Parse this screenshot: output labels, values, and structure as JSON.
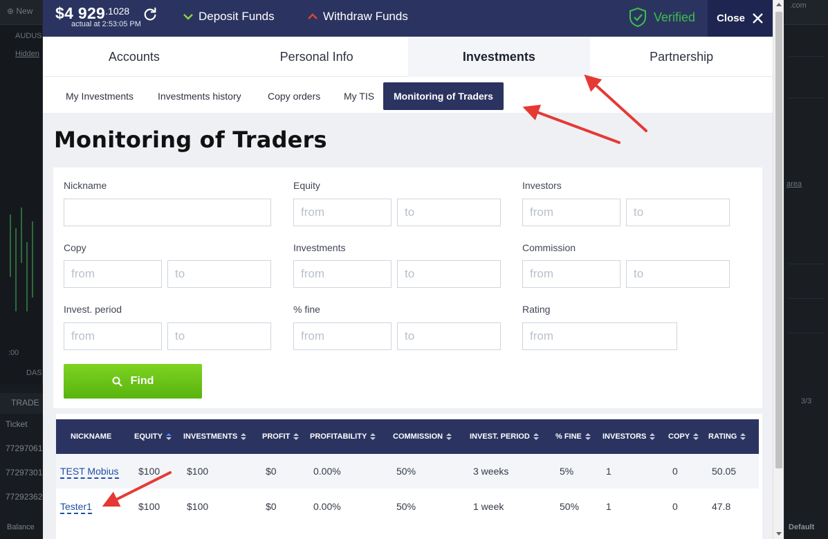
{
  "background": {
    "new_label": "New",
    "symbol": "AUDUS",
    "hidden_link": "Hidden",
    "trade_tab": "TRADE",
    "ticket_header": "Ticket",
    "ticket_rows": [
      "77297061",
      "77297301",
      "77292362"
    ],
    "balance_label": "Balance",
    "area_link": "area",
    "pager": "3/3",
    "default_label": "Default",
    "url_fragment": ".com",
    "dash_label": "DAS",
    "time_label": ":00"
  },
  "topbar": {
    "balance_integer": "$4 929",
    "balance_decimal": ".1028",
    "balance_time": "actual at 2:53:05 PM",
    "deposit_label": "Deposit Funds",
    "withdraw_label": "Withdraw Funds",
    "verified_label": "Verified",
    "close_label": "Close"
  },
  "tabs": [
    {
      "label": "Accounts"
    },
    {
      "label": "Personal Info"
    },
    {
      "label": "Investments"
    },
    {
      "label": "Partnership"
    }
  ],
  "subtabs": [
    {
      "label": "My Investments"
    },
    {
      "label": "Investments history"
    },
    {
      "label": "Copy orders"
    },
    {
      "label": "My TIS"
    },
    {
      "label": "Monitoring of Traders"
    }
  ],
  "page_title": "Monitoring of Traders",
  "filters": {
    "nickname_label": "Nickname",
    "equity_label": "Equity",
    "investors_label": "Investors",
    "copy_label": "Copy",
    "investments_label": "Investments",
    "commission_label": "Commission",
    "invest_period_label": "Invest. period",
    "fine_label": "% fine",
    "rating_label": "Rating",
    "from_placeholder": "from",
    "to_placeholder": "to",
    "find_label": "Find"
  },
  "table": {
    "headers": [
      "NICKNAME",
      "EQUITY",
      "INVESTMENTS",
      "PROFIT",
      "PROFITABILITY",
      "COMMISSION",
      "INVEST. PERIOD",
      "% FINE",
      "INVESTORS",
      "COPY",
      "RATING"
    ],
    "rows": [
      [
        "TEST Mobius",
        "$100",
        "$100",
        "$0",
        "0.00%",
        "50%",
        "3 weeks",
        "5%",
        "1",
        "0",
        "50.05"
      ],
      [
        "Tester1",
        "$100",
        "$100",
        "$0",
        "0.00%",
        "50%",
        "1 week",
        "50%",
        "1",
        "0",
        "47.8"
      ]
    ]
  },
  "colors": {
    "navy": "#2b3460",
    "green_button": "#6cc51a",
    "verified_green": "#3bbf4b",
    "annotation_red": "#e53935",
    "link_blue": "#1f4fa3"
  }
}
